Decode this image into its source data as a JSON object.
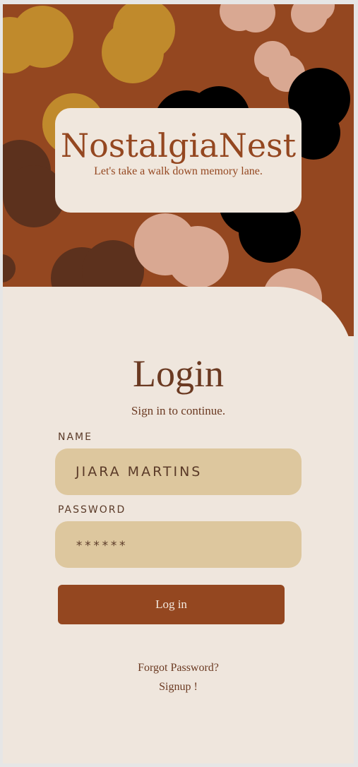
{
  "brand": {
    "title": "NostalgiaNest",
    "tagline": "Let's take a walk down memory lane."
  },
  "login": {
    "title": "Login",
    "subtitle": "Sign in to continue.",
    "name_label": "NAME",
    "name_value": "JIARA MARTINS",
    "password_label": "PASSWORD",
    "password_value": "******",
    "submit_label": "Log in",
    "forgot_label": "Forgot Password?",
    "signup_label": "Signup !"
  },
  "colors": {
    "primary": "#944720",
    "background": "#efe6dd",
    "field": "#ddc79e",
    "mustard": "#c08a2c",
    "peach": "#d9a892",
    "dark_brown": "#5c311d",
    "black": "#000000"
  }
}
